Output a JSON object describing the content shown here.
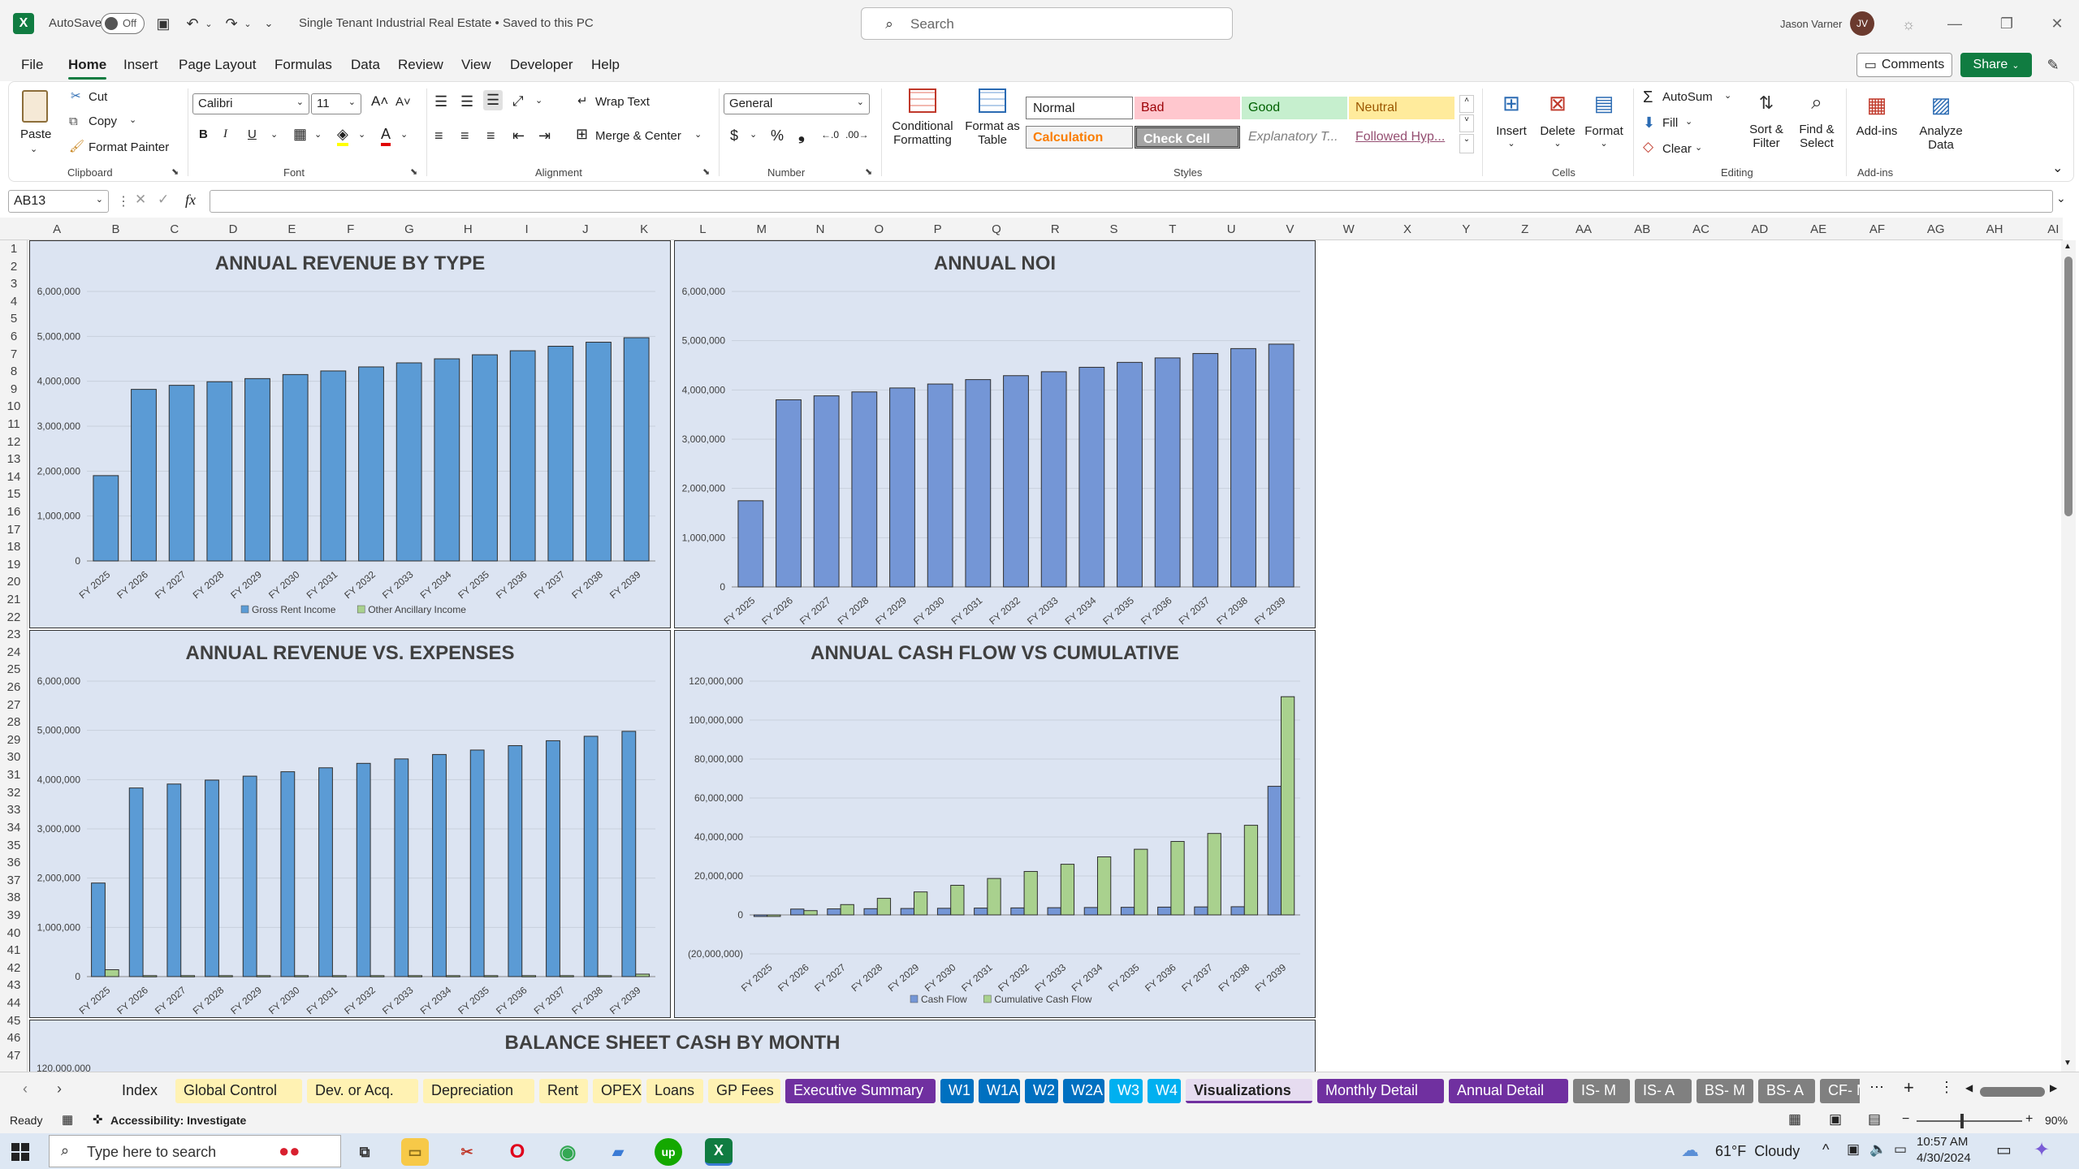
{
  "titlebar": {
    "autosave_label": "AutoSave",
    "toggle_label": "Off",
    "doc_title": "Single Tenant Industrial Real Estate • Saved to this PC",
    "search_placeholder": "Search",
    "user_name": "Jason Varner",
    "user_initials": "JV"
  },
  "menu": {
    "tabs": [
      "File",
      "Home",
      "Insert",
      "Page Layout",
      "Formulas",
      "Data",
      "Review",
      "View",
      "Developer",
      "Help"
    ],
    "active": "Home",
    "comments": "Comments",
    "share": "Share"
  },
  "ribbon": {
    "clipboard": {
      "paste": "Paste",
      "cut": "Cut",
      "copy": "Copy",
      "format_painter": "Format Painter",
      "group": "Clipboard"
    },
    "font": {
      "name": "Calibri",
      "size": "11",
      "group": "Font"
    },
    "alignment": {
      "wrap": "Wrap Text",
      "merge": "Merge & Center",
      "group": "Alignment"
    },
    "number": {
      "format": "General",
      "group": "Number"
    },
    "styles": {
      "conditional": "Conditional",
      "formatting": "Formatting",
      "format_as": "Format as",
      "table": "Table",
      "normal": "Normal",
      "bad": "Bad",
      "good": "Good",
      "neutral": "Neutral",
      "calculation": "Calculation",
      "check_cell": "Check Cell",
      "explanatory": "Explanatory T...",
      "followed": "Followed Hyp...",
      "group": "Styles"
    },
    "cells": {
      "insert": "Insert",
      "delete": "Delete",
      "format": "Format",
      "group": "Cells"
    },
    "editing": {
      "autosum": "AutoSum",
      "fill": "Fill",
      "clear": "Clear",
      "sort": "Sort &",
      "filter": "Filter",
      "find": "Find &",
      "select": "Select",
      "group": "Editing"
    },
    "addins": {
      "addins": "Add-ins",
      "analyze": "Analyze",
      "data": "Data",
      "group": "Add-ins"
    }
  },
  "formula_bar": {
    "name_box": "AB13",
    "fx": "fx",
    "value": ""
  },
  "columns": [
    "A",
    "B",
    "C",
    "D",
    "E",
    "F",
    "G",
    "H",
    "I",
    "J",
    "K",
    "L",
    "M",
    "N",
    "O",
    "P",
    "Q",
    "R",
    "S",
    "T",
    "U",
    "V",
    "W",
    "X",
    "Y",
    "Z",
    "AA",
    "AB",
    "AC",
    "AD",
    "AE",
    "AF",
    "AG",
    "AH",
    "AI"
  ],
  "rows": [
    "1",
    "2",
    "3",
    "4",
    "5",
    "6",
    "7",
    "8",
    "9",
    "10",
    "11",
    "12",
    "13",
    "14",
    "15",
    "16",
    "17",
    "18",
    "19",
    "20",
    "21",
    "22",
    "23",
    "24",
    "25",
    "26",
    "27",
    "28",
    "29",
    "30",
    "31",
    "32",
    "33",
    "34",
    "35",
    "36",
    "37",
    "38",
    "39",
    "40",
    "41",
    "42",
    "43",
    "44",
    "45",
    "46",
    "47"
  ],
  "chart_data": [
    {
      "type": "bar",
      "title": "ANNUAL REVENUE BY TYPE",
      "categories": [
        "FY 2025",
        "FY 2026",
        "FY 2027",
        "FY 2028",
        "FY 2029",
        "FY 2030",
        "FY 2031",
        "FY 2032",
        "FY 2033",
        "FY 2034",
        "FY 2035",
        "FY 2036",
        "FY 2037",
        "FY 2038",
        "FY 2039"
      ],
      "series": [
        {
          "name": "Gross Rent Income",
          "color": "#5b9bd5",
          "values": [
            1900000,
            3820000,
            3910000,
            3990000,
            4060000,
            4150000,
            4230000,
            4320000,
            4410000,
            4500000,
            4590000,
            4680000,
            4780000,
            4870000,
            4970000
          ]
        },
        {
          "name": "Other Ancillary Income",
          "color": "#a9d18e",
          "values": [
            0,
            0,
            0,
            0,
            0,
            0,
            0,
            0,
            0,
            0,
            0,
            0,
            0,
            0,
            0
          ]
        }
      ],
      "yticks": [
        "6,000,000",
        "5,000,000",
        "4,000,000",
        "3,000,000",
        "2,000,000",
        "1,000,000",
        "0"
      ],
      "ylim": [
        0,
        6000000
      ],
      "stacked": true,
      "legend": "bottom"
    },
    {
      "type": "bar",
      "title": "ANNUAL NOI",
      "categories": [
        "FY 2025",
        "FY 2026",
        "FY 2027",
        "FY 2028",
        "FY 2029",
        "FY 2030",
        "FY 2031",
        "FY 2032",
        "FY 2033",
        "FY 2034",
        "FY 2035",
        "FY 2036",
        "FY 2037",
        "FY 2038",
        "FY 2039"
      ],
      "series": [
        {
          "color": "#7496d6",
          "values": [
            1750000,
            3800000,
            3880000,
            3960000,
            4040000,
            4120000,
            4210000,
            4290000,
            4370000,
            4460000,
            4560000,
            4650000,
            4740000,
            4840000,
            4930000
          ]
        }
      ],
      "yticks": [
        "6,000,000",
        "5,000,000",
        "4,000,000",
        "3,000,000",
        "2,000,000",
        "1,000,000",
        "0"
      ],
      "ylim": [
        0,
        6000000
      ]
    },
    {
      "type": "bar",
      "title": "ANNUAL REVENUE VS. EXPENSES",
      "categories": [
        "FY 2025",
        "FY 2026",
        "FY 2027",
        "FY 2028",
        "FY 2029",
        "FY 2030",
        "FY 2031",
        "FY 2032",
        "FY 2033",
        "FY 2034",
        "FY 2035",
        "FY 2036",
        "FY 2037",
        "FY 2038",
        "FY 2039"
      ],
      "series": [
        {
          "color": "#5b9bd5",
          "values": [
            1900000,
            3830000,
            3910000,
            3990000,
            4070000,
            4160000,
            4240000,
            4330000,
            4420000,
            4510000,
            4600000,
            4690000,
            4790000,
            4880000,
            4980000
          ]
        },
        {
          "color": "#a9d18e",
          "values": [
            140000,
            20000,
            20000,
            20000,
            20000,
            20000,
            20000,
            20000,
            20000,
            20000,
            20000,
            20000,
            20000,
            20000,
            50000
          ]
        }
      ],
      "yticks": [
        "6,000,000",
        "5,000,000",
        "4,000,000",
        "3,000,000",
        "2,000,000",
        "1,000,000",
        "0"
      ],
      "ylim": [
        0,
        6000000
      ]
    },
    {
      "type": "bar",
      "title": "ANNUAL CASH FLOW VS CUMULATIVE",
      "categories": [
        "FY 2025",
        "FY 2026",
        "FY 2027",
        "FY 2028",
        "FY 2029",
        "FY 2030",
        "FY 2031",
        "FY 2032",
        "FY 2033",
        "FY 2034",
        "FY 2035",
        "FY 2036",
        "FY 2037",
        "FY 2038",
        "FY 2039"
      ],
      "series": [
        {
          "name": "Cash Flow",
          "color": "#7496d6",
          "values": [
            -800000,
            3000000,
            3100000,
            3200000,
            3300000,
            3400000,
            3500000,
            3600000,
            3700000,
            3800000,
            3900000,
            4000000,
            4100000,
            4200000,
            66000000
          ]
        },
        {
          "name": "Cumulative Cash Flow",
          "color": "#a9d18e",
          "values": [
            -800000,
            2200000,
            5300000,
            8500000,
            11800000,
            15200000,
            18700000,
            22300000,
            26000000,
            29800000,
            33700000,
            37700000,
            41800000,
            46000000,
            112000000
          ]
        }
      ],
      "yticks": [
        "120,000,000",
        "100,000,000",
        "80,000,000",
        "60,000,000",
        "40,000,000",
        "20,000,000",
        "0",
        "(20,000,000)"
      ],
      "ylim": [
        -20000000,
        120000000
      ],
      "legend": "bottom"
    }
  ],
  "bottom_chart": {
    "title": "BALANCE SHEET CASH BY MONTH",
    "ytick": "120,000,000"
  },
  "sheet_tabs": [
    {
      "label": "Index",
      "bg": "#f3f3f3",
      "fg": "#222"
    },
    {
      "label": "Global Control",
      "bg": "#fff2b3",
      "fg": "#222"
    },
    {
      "label": "Dev. or Acq.",
      "bg": "#fff2b3",
      "fg": "#222"
    },
    {
      "label": "Depreciation",
      "bg": "#fff2b3",
      "fg": "#222"
    },
    {
      "label": "Rent",
      "bg": "#fff2b3",
      "fg": "#222"
    },
    {
      "label": "OPEX",
      "bg": "#fff2b3",
      "fg": "#222"
    },
    {
      "label": "Loans",
      "bg": "#fff2b3",
      "fg": "#222"
    },
    {
      "label": "GP Fees",
      "bg": "#fff2b3",
      "fg": "#222"
    },
    {
      "label": "Executive Summary",
      "bg": "#7030a0",
      "fg": "#fff"
    },
    {
      "label": "W1",
      "bg": "#0070c0",
      "fg": "#fff"
    },
    {
      "label": "W1A",
      "bg": "#0070c0",
      "fg": "#fff"
    },
    {
      "label": "W2",
      "bg": "#0070c0",
      "fg": "#fff"
    },
    {
      "label": "W2A",
      "bg": "#0070c0",
      "fg": "#fff"
    },
    {
      "label": "W3",
      "bg": "#00b0f0",
      "fg": "#fff"
    },
    {
      "label": "W4",
      "bg": "#00b0f0",
      "fg": "#fff"
    },
    {
      "label": "Visualizations",
      "bg": "#e6dcf0",
      "fg": "#222"
    },
    {
      "label": "Monthly Detail",
      "bg": "#7030a0",
      "fg": "#fff"
    },
    {
      "label": "Annual Detail",
      "bg": "#7030a0",
      "fg": "#fff"
    },
    {
      "label": "IS- M",
      "bg": "#808080",
      "fg": "#fff"
    },
    {
      "label": "IS- A",
      "bg": "#808080",
      "fg": "#fff"
    },
    {
      "label": "BS- M",
      "bg": "#808080",
      "fg": "#fff"
    },
    {
      "label": "BS- A",
      "bg": "#808080",
      "fg": "#fff"
    },
    {
      "label": "CF- M",
      "bg": "#808080",
      "fg": "#fff"
    }
  ],
  "active_sheet": "Visualizations",
  "status": {
    "ready": "Ready",
    "accessibility": "Accessibility: Investigate",
    "zoom": "90%"
  },
  "taskbar": {
    "search_placeholder": "Type here to search",
    "weather": "61°F  Cloudy",
    "time": "10:57 AM",
    "date": "4/30/2024"
  }
}
